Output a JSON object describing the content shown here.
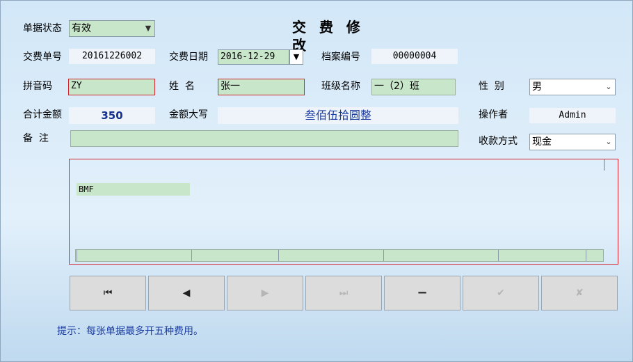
{
  "title": "交 费 修 改",
  "status": {
    "label": "单据状态",
    "value": "有效"
  },
  "receipt_no": {
    "label": "交费单号",
    "value": "20161226002"
  },
  "pay_date": {
    "label": "交费日期",
    "value": "2016-12-29"
  },
  "file_no": {
    "label": "档案编号",
    "value": "00000004"
  },
  "pinyin": {
    "label": "拼音码",
    "value": "ZY"
  },
  "name": {
    "label": "姓  名",
    "value": "张一"
  },
  "class_name": {
    "label": "班级名称",
    "value": "一（2）班"
  },
  "gender": {
    "label": "性  别",
    "value": "男"
  },
  "total": {
    "label": "合计金额",
    "value": "350"
  },
  "amount_words": {
    "label": "金额大写",
    "value": "叁佰伍拾圆整"
  },
  "operator": {
    "label": "操作者",
    "value": "Admin"
  },
  "remark": {
    "label": "备  注",
    "value": ""
  },
  "pay_method": {
    "label": "收款方式",
    "value": "现金"
  },
  "grid": {
    "cell_value": "BMF"
  },
  "nav": {
    "first": "⏮",
    "prev": "◀",
    "next": "▶",
    "last": "⏭",
    "delete": "−",
    "confirm": "✔",
    "cancel": "✘"
  },
  "hint": "提示：每张单据最多开五种费用。"
}
